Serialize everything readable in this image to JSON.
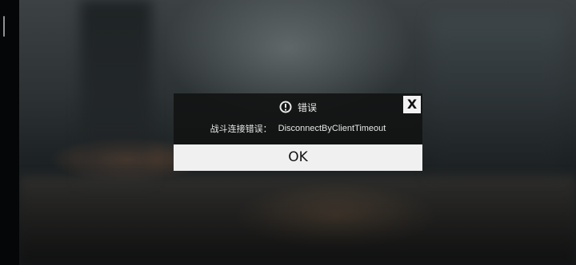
{
  "dialog": {
    "title": "错误",
    "icon": "alert-circle-icon",
    "close_label": "X",
    "message_prefix": "战斗连接错误：",
    "message_detail": "DisconnectByClientTimeout",
    "ok_label": "OK"
  },
  "colors": {
    "dialog_bg": "#121314",
    "button_bg": "#f0f0f0",
    "text_light": "#e9e9e9",
    "text_dark": "#111111"
  }
}
